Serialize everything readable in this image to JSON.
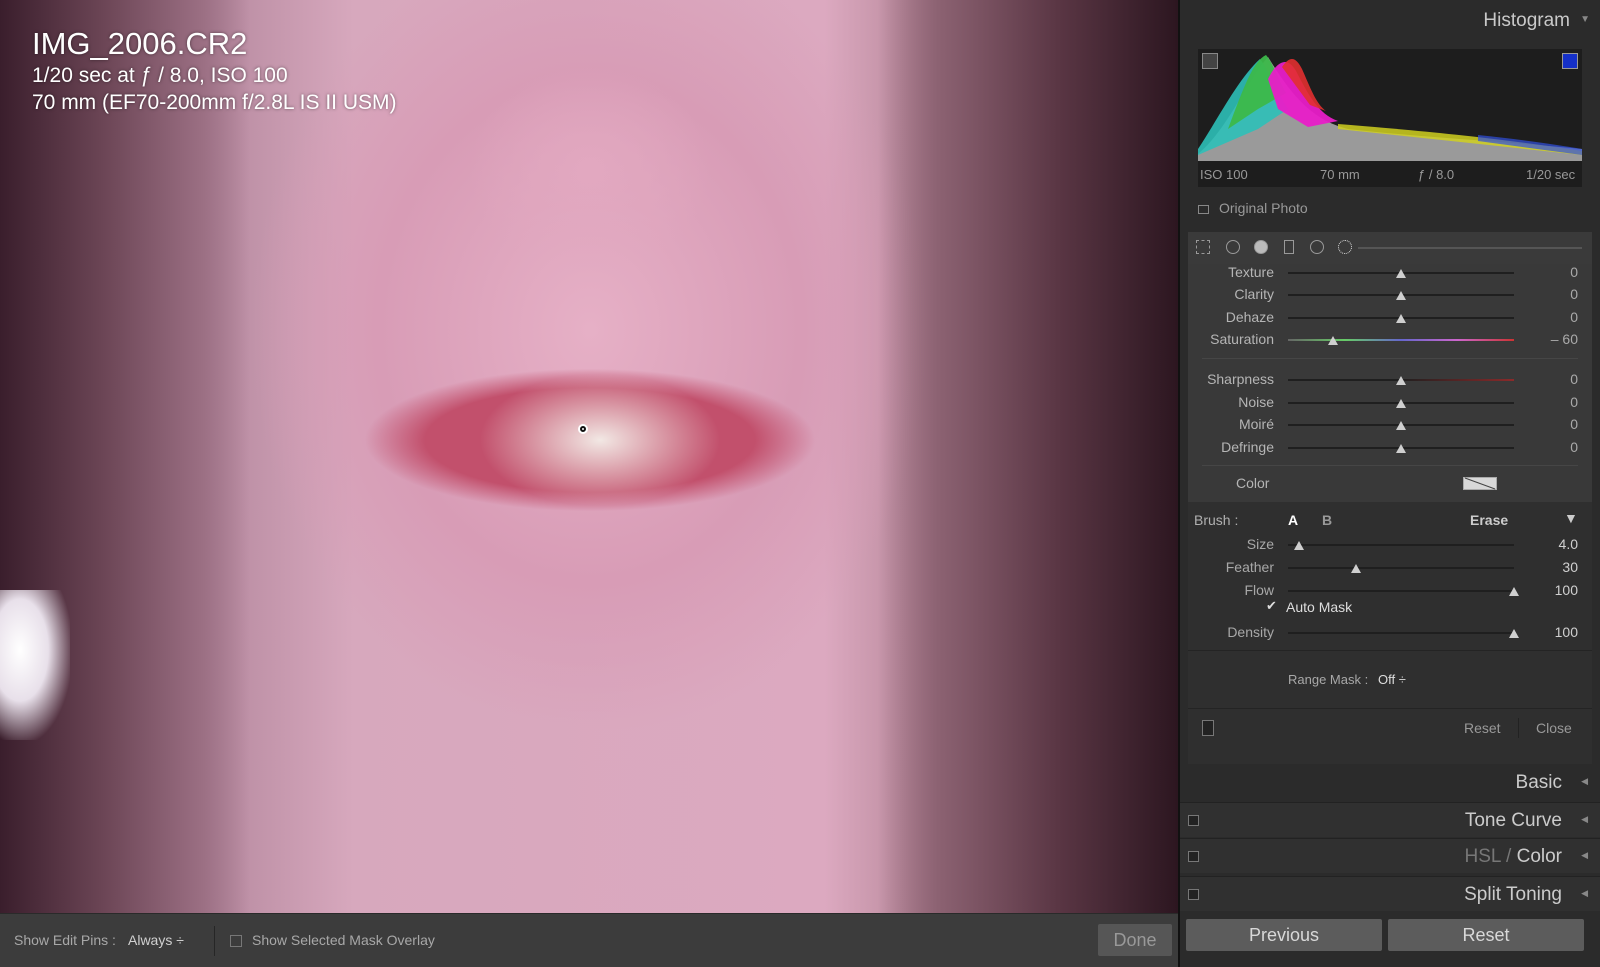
{
  "photo": {
    "filename": "IMG_2006.CR2",
    "exposure": "1/20 sec at ƒ / 8.0, ISO 100",
    "lens": "70 mm (EF70-200mm f/2.8L IS II USM)"
  },
  "toolbar": {
    "show_edit_pins_label": "Show Edit Pins :",
    "show_edit_pins_value": "Always ÷",
    "mask_overlay_label": "Show Selected Mask Overlay",
    "mask_overlay_checked": false,
    "done_label": "Done"
  },
  "histogram": {
    "title": "Histogram",
    "iso": "ISO 100",
    "focal": "70 mm",
    "aperture": "ƒ / 8.0",
    "shutter": "1/20 sec",
    "original_photo_label": "Original Photo"
  },
  "effects": [
    {
      "name": "Texture",
      "value": "0",
      "level": 0.5
    },
    {
      "name": "Clarity",
      "value": "0",
      "level": 0.5
    },
    {
      "name": "Dehaze",
      "value": "0",
      "level": 0.5
    },
    {
      "name": "Saturation",
      "value": "– 60",
      "level": 0.2
    },
    {
      "name": "Sharpness",
      "value": "0",
      "level": 0.5
    },
    {
      "name": "Noise",
      "value": "0",
      "level": 0.5
    },
    {
      "name": "Moiré",
      "value": "0",
      "level": 0.5
    },
    {
      "name": "Defringe",
      "value": "0",
      "level": 0.5
    }
  ],
  "color": {
    "label": "Color"
  },
  "brush": {
    "label": "Brush :",
    "a": "A",
    "b": "B",
    "erase": "Erase",
    "settings": [
      {
        "name": "Size",
        "value": "4.0",
        "level": 0.05
      },
      {
        "name": "Feather",
        "value": "30",
        "level": 0.3
      },
      {
        "name": "Flow",
        "value": "100",
        "level": 1.0
      }
    ],
    "auto_mask_label": "Auto Mask",
    "auto_mask_checked": true,
    "density": {
      "name": "Density",
      "value": "100",
      "level": 1.0
    },
    "range_mask_label": "Range Mask :",
    "range_mask_value": "Off ÷",
    "reset_label": "Reset",
    "close_label": "Close"
  },
  "panels": [
    {
      "title": "Basic"
    },
    {
      "title": "Tone Curve"
    },
    {
      "title_dim": "HSL /",
      "title": "Color"
    },
    {
      "title": "Split Toning"
    }
  ],
  "buttons": {
    "previous": "Previous",
    "reset": "Reset"
  },
  "colors": {
    "panel_bg": "#2b2b2b",
    "section_bg": "#393939",
    "accent_blue": "#1530c8"
  }
}
